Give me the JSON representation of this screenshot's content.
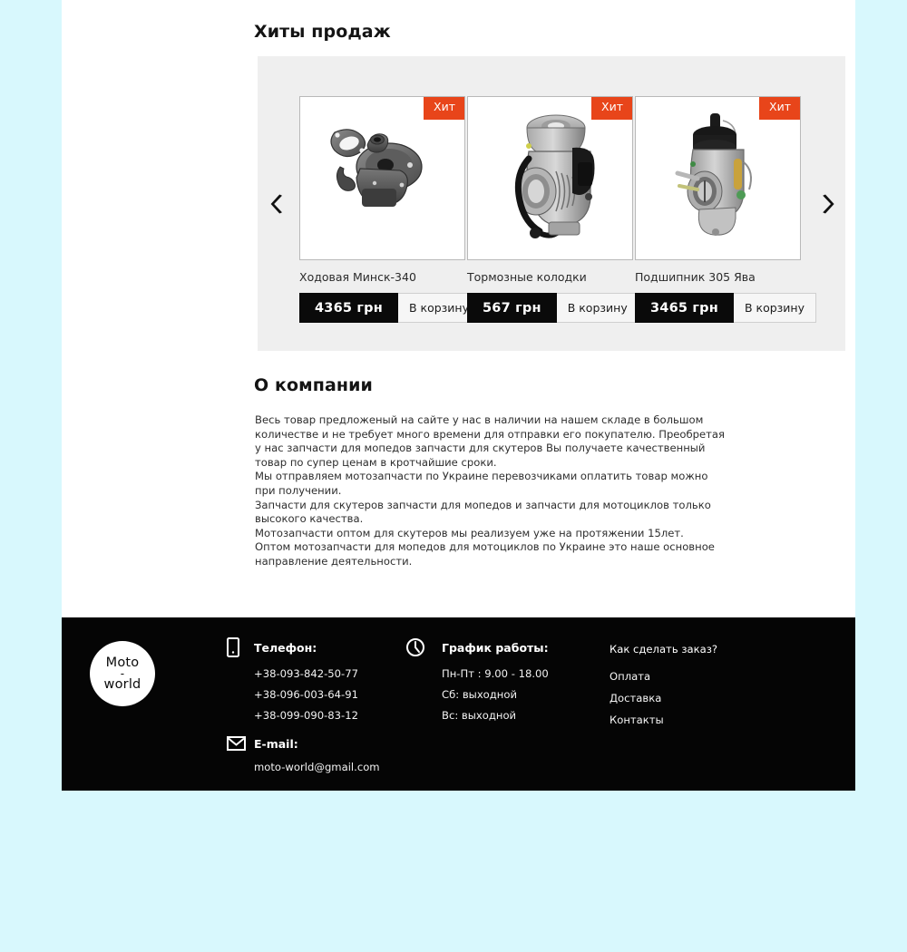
{
  "theme": {
    "page_bg": "#d8f8fd",
    "content_bg": "#ffffff",
    "carousel_bg": "#efefef",
    "badge_color": "#e8451a",
    "price_bg": "#0a0a0a",
    "footer_bg": "#050505"
  },
  "sections": {
    "hits_title": "Хиты продаж",
    "about_title": "О компании"
  },
  "carousel": {
    "prev_icon": "chevron-left-icon",
    "next_icon": "chevron-right-icon",
    "products": [
      {
        "badge": "Хит",
        "name": "Ходовая Минск-340",
        "price": "4365 грн",
        "cart_label": "В корзину",
        "image": "fuel-pump-photo"
      },
      {
        "badge": "Хит",
        "name": "Тормозные колодки",
        "price": "567 грн",
        "cart_label": "В корзину",
        "image": "carburetor-photo"
      },
      {
        "badge": "Хит",
        "name": "Подшипник 305 Ява",
        "price": "3465 грн",
        "cart_label": "В корзину",
        "image": "carburetor-dellorto-photo"
      }
    ]
  },
  "about": {
    "paragraphs": [
      "Весь товар предложеный на сайте у нас в наличии на нашем складе в большом количестве и не требует много времени  для отправки его покупателю. Преобретая у нас запчасти для мопедов запчасти для скутеров Вы получаете качественный товар по супер ценам в кротчайшие сроки.",
      "Мы отправляем мотозапчасти по Украине перевозчиками оплатить товар можно при получении.",
      "Запчасти для скутеров запчасти для мопедов и запчасти для мотоциклов только высокого качества.",
      "Мотозапчасти оптом для скутеров мы реализуем уже на протяжении 15лет.",
      "Оптом мотозапчасти для мопедов для мотоциклов по Украине это наше основное направление деятельности."
    ]
  },
  "footer": {
    "logo": {
      "line1": "Moto",
      "dash": "-",
      "line2": "world"
    },
    "phone": {
      "icon": "phone-icon",
      "heading": "Телефон:",
      "numbers": [
        "+38-093-842-50-77",
        "+38-096-003-64-91",
        "+38-099-090-83-12"
      ]
    },
    "email": {
      "icon": "envelope-icon",
      "heading": "E-mail:",
      "address": "moto-world@gmail.com"
    },
    "hours": {
      "icon": "clock-icon",
      "heading": "График работы:",
      "rows": [
        "Пн-Пт : 9.00 - 18.00",
        "Сб: выходной",
        "Вс: выходной"
      ]
    },
    "links": {
      "heading": "Как сделать заказ?",
      "items": [
        "Оплата",
        "Доставка",
        "Контакты"
      ]
    }
  }
}
